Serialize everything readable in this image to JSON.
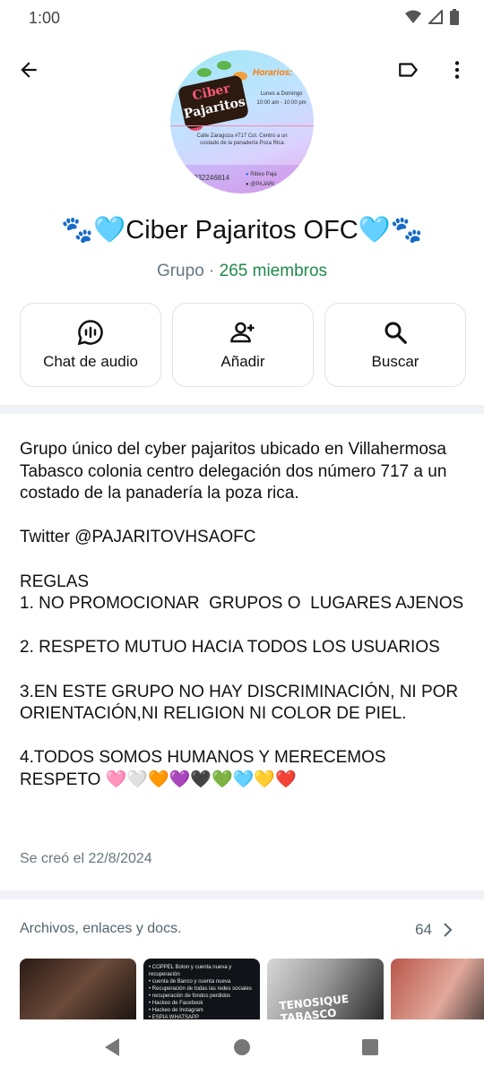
{
  "status_bar": {
    "time": "1:00"
  },
  "group": {
    "title": "🐾🩵Ciber Pajaritos OFC🩵🐾",
    "type_label": "Grupo · ",
    "members": "265 miembros"
  },
  "avatar_art": {
    "brand_line1": "Ciber",
    "brand_line2": "Pajaritos",
    "hours_title": "Horarios:",
    "hours_days": "Lunes a Domingo",
    "hours_time": "10:00 am - 10:00 pm",
    "address": "Calle Zaragoza #717 Col. Centro a un costado de la panadería Poza Rica",
    "phone": "932246814",
    "social_fb": "Ribeo Paja",
    "social_x": "@PAJARI"
  },
  "actions": [
    {
      "label": "Chat de audio",
      "icon": "audio-chat-icon"
    },
    {
      "label": "Añadir",
      "icon": "add-person-icon"
    },
    {
      "label": "Buscar",
      "icon": "search-icon"
    }
  ],
  "description": "Grupo único del cyber pajaritos ubicado en Villahermosa Tabasco colonia centro delegación dos número 717 a un costado de la panadería la poza rica.\n\nTwitter @PAJARITOVHSAOFC\n\nREGLAS\n1. NO PROMOCIONAR  GRUPOS O  LUGARES AJENOS\n\n2. RESPETO MUTUO HACIA TODOS LOS USUARIOS\n\n3.EN ESTE GRUPO NO HAY DISCRIMINACIÓN, NI POR ORIENTACIÓN,NI RELIGION NI COLOR DE PIEL.\n\n4.TODOS SOMOS HUMANOS Y MERECEMOS RESPETO 🩷🤍🧡💜🖤💚🩵💛❤️",
  "created": "Se creó el 22/8/2024",
  "files": {
    "title": "Archivos, enlaces y docs.",
    "count": "64",
    "thumb2_text": "• COPPEL Boton y cuenta nueva y recuperación\n• cuenta de Banco y cuenta nueva\n• Recuperación de todas las redes sociales\n• recuperación de fondos perdidos\n• Hackeo de Facebook\n• Hackeo de Instagram\n• ESPIA WHATSAPP",
    "thumb3_caption": "TENOSIQUE TABASCO"
  }
}
